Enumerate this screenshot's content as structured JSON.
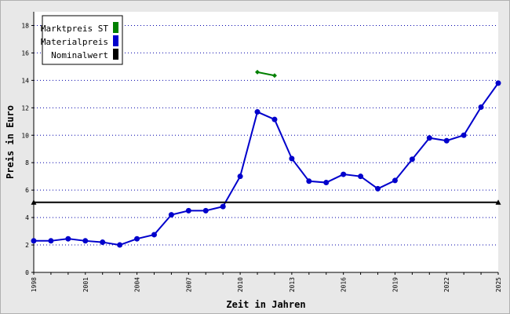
{
  "chart_data": {
    "type": "line",
    "xlabel": "Zeit in Jahren",
    "ylabel": "Preis in Euro",
    "xlim": [
      1998,
      2025
    ],
    "ylim": [
      0,
      19
    ],
    "yticks": [
      0,
      2,
      4,
      6,
      8,
      10,
      12,
      14,
      16,
      18
    ],
    "xticks": [
      1998,
      2001,
      2004,
      2007,
      2010,
      2013,
      2016,
      2019,
      2022,
      2025
    ],
    "grid": "horizontal dotted",
    "legend_position": "top-left",
    "series": [
      {
        "name": "Marktpreis ST",
        "color": "#008000",
        "x": [
          2011,
          2012
        ],
        "y": [
          14.6,
          14.35
        ]
      },
      {
        "name": "Materialpreis",
        "color": "#0000cc",
        "x": [
          1998,
          1999,
          2000,
          2001,
          2002,
          2003,
          2004,
          2005,
          2006,
          2007,
          2008,
          2009,
          2010,
          2011,
          2012,
          2013,
          2014,
          2015,
          2016,
          2017,
          2018,
          2019,
          2020,
          2021,
          2022,
          2023,
          2024,
          2025
        ],
        "y": [
          2.3,
          2.3,
          2.45,
          2.3,
          2.2,
          2.0,
          2.45,
          2.75,
          4.2,
          4.5,
          4.5,
          4.8,
          7.0,
          11.7,
          11.15,
          8.3,
          6.65,
          6.55,
          7.15,
          7.0,
          6.1,
          6.7,
          8.25,
          9.8,
          9.6,
          10.0,
          12.05,
          13.8
        ]
      },
      {
        "name": "Nominalwert",
        "color": "#000000",
        "x": [
          1998,
          2025
        ],
        "y": [
          5.11,
          5.11
        ]
      }
    ]
  }
}
